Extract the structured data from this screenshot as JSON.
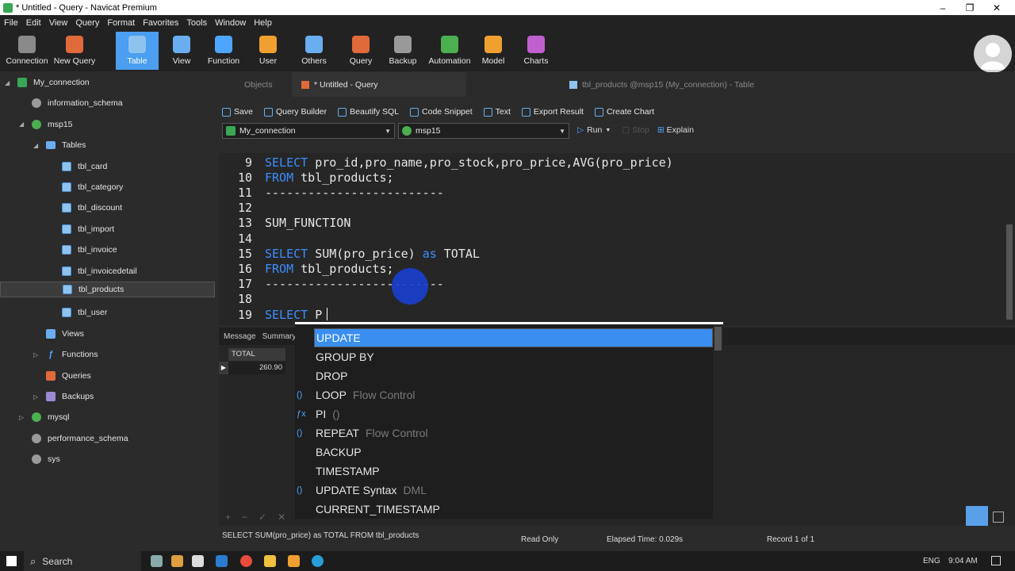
{
  "window": {
    "title": "* Untitled - Query - Navicat Premium",
    "controls": [
      "–",
      "❐",
      "✕"
    ]
  },
  "menu": [
    "File",
    "Edit",
    "View",
    "Query",
    "Format",
    "Favorites",
    "Tools",
    "Window",
    "Help"
  ],
  "toolbar": [
    {
      "label": "Connection",
      "icon": "connection-icon",
      "color": "#8a8a8a"
    },
    {
      "label": "New Query",
      "icon": "new-query-icon",
      "color": "#e06a3a"
    },
    {
      "label": "Table",
      "icon": "table-icon",
      "color": "#8ec3ef",
      "active": true
    },
    {
      "label": "View",
      "icon": "view-icon",
      "color": "#6aaef0"
    },
    {
      "label": "Function",
      "icon": "function-icon",
      "color": "#4ea5ff"
    },
    {
      "label": "User",
      "icon": "user-icon",
      "color": "#f0a030"
    },
    {
      "label": "Others",
      "icon": "others-icon",
      "color": "#6aaef0"
    },
    {
      "label": "Query",
      "icon": "query-icon",
      "color": "#e06a3a"
    },
    {
      "label": "Backup",
      "icon": "backup-icon",
      "color": "#999"
    },
    {
      "label": "Automation",
      "icon": "automation-icon",
      "color": "#4caf50"
    },
    {
      "label": "Model",
      "icon": "model-icon",
      "color": "#f0a030"
    },
    {
      "label": "Charts",
      "icon": "charts-icon",
      "color": "#c060d0"
    }
  ],
  "tree": [
    {
      "label": "My_connection",
      "icon": "conn",
      "indent": 0,
      "arrow": "◢"
    },
    {
      "label": "information_schema",
      "icon": "db-grey",
      "indent": 1
    },
    {
      "label": "msp15",
      "icon": "db-green",
      "indent": 1,
      "arrow": "◢"
    },
    {
      "label": "Tables",
      "icon": "folder",
      "indent": 2,
      "arrow": "◢"
    },
    {
      "label": "tbl_card",
      "icon": "table",
      "indent": 3
    },
    {
      "label": "tbl_category",
      "icon": "table",
      "indent": 3
    },
    {
      "label": "tbl_discount",
      "icon": "table",
      "indent": 3
    },
    {
      "label": "tbl_import",
      "icon": "table",
      "indent": 3
    },
    {
      "label": "tbl_invoice",
      "icon": "table",
      "indent": 3
    },
    {
      "label": "tbl_invoicedetail",
      "icon": "table",
      "indent": 3
    },
    {
      "label": "tbl_products",
      "icon": "table",
      "indent": 3,
      "selected": true
    },
    {
      "label": "tbl_user",
      "icon": "table",
      "indent": 3
    },
    {
      "label": "Views",
      "icon": "view",
      "indent": 2
    },
    {
      "label": "Functions",
      "icon": "func",
      "indent": 2,
      "arrow": "▷"
    },
    {
      "label": "Queries",
      "icon": "query",
      "indent": 2
    },
    {
      "label": "Backups",
      "icon": "backup",
      "indent": 2,
      "arrow": "▷"
    },
    {
      "label": "mysql",
      "icon": "db-green",
      "indent": 1,
      "arrow": "▷"
    },
    {
      "label": "performance_schema",
      "icon": "db-grey",
      "indent": 1
    },
    {
      "label": "sys",
      "icon": "db-grey",
      "indent": 1
    }
  ],
  "tabs": [
    {
      "label": "Objects",
      "active": false
    },
    {
      "label": "* Untitled - Query",
      "active": true
    },
    {
      "label": "tbl_products @msp15 (My_connection) - Table",
      "active": false
    }
  ],
  "query_toolbar": [
    "Save",
    "Query Builder",
    "Beautify SQL",
    "Code Snippet",
    "Text",
    "Export Result",
    "Create Chart"
  ],
  "connection_select": "My_connection",
  "database_select": "msp15",
  "run_controls": {
    "run": "Run",
    "stop": "Stop",
    "explain": "Explain"
  },
  "editor_lines": [
    {
      "num": "9",
      "parts": [
        [
          "kw",
          "SELECT"
        ],
        [
          "t",
          " pro_id,pro_name,pro_stock,pro_price,AVG(pro_price)"
        ]
      ]
    },
    {
      "num": "10",
      "parts": [
        [
          "kw",
          "FROM"
        ],
        [
          "t",
          " tbl_products;"
        ]
      ]
    },
    {
      "num": "11",
      "parts": [
        [
          "t",
          "-------------------------"
        ]
      ]
    },
    {
      "num": "12",
      "parts": []
    },
    {
      "num": "13",
      "parts": [
        [
          "t",
          "SUM_FUNCTION"
        ]
      ]
    },
    {
      "num": "14",
      "parts": []
    },
    {
      "num": "15",
      "parts": [
        [
          "kw",
          "SELECT"
        ],
        [
          "t",
          " SUM(pro_price) "
        ],
        [
          "kw",
          "as"
        ],
        [
          "t",
          " TOTAL"
        ]
      ]
    },
    {
      "num": "16",
      "parts": [
        [
          "kw",
          "FROM"
        ],
        [
          "t",
          " tbl_products;"
        ]
      ]
    },
    {
      "num": "17",
      "parts": [
        [
          "t",
          "-------------------------"
        ]
      ]
    },
    {
      "num": "18",
      "parts": []
    },
    {
      "num": "19",
      "parts": [
        [
          "kw",
          "SELECT"
        ],
        [
          "t",
          " P"
        ]
      ]
    }
  ],
  "result_tabs": [
    "Message",
    "Summary"
  ],
  "result_grid": {
    "header": "TOTAL",
    "value": "260.90"
  },
  "autocomplete": [
    {
      "label": "UPDATE",
      "hint": "",
      "icon": "",
      "selected": true
    },
    {
      "label": "GROUP BY",
      "hint": "",
      "icon": ""
    },
    {
      "label": "DROP",
      "hint": "",
      "icon": ""
    },
    {
      "label": "LOOP",
      "hint": "Flow Control",
      "icon": "()"
    },
    {
      "label": "PI",
      "hint": "()",
      "icon": "ƒx"
    },
    {
      "label": "REPEAT",
      "hint": "Flow Control",
      "icon": "()"
    },
    {
      "label": "BACKUP",
      "hint": "",
      "icon": ""
    },
    {
      "label": "TIMESTAMP",
      "hint": "",
      "icon": ""
    },
    {
      "label": "UPDATE Syntax",
      "hint": "DML",
      "icon": "()"
    },
    {
      "label": "CURRENT_TIMESTAMP",
      "hint": "",
      "icon": ""
    }
  ],
  "status": {
    "sql": "SELECT SUM(pro_price) as TOTAL FROM tbl_products",
    "mode": "Read Only",
    "elapsed": "Elapsed Time: 0.029s",
    "record": "Record 1 of 1"
  },
  "taskbar": {
    "search": "Search",
    "lang": "ENG",
    "time": "9:04 AM"
  }
}
